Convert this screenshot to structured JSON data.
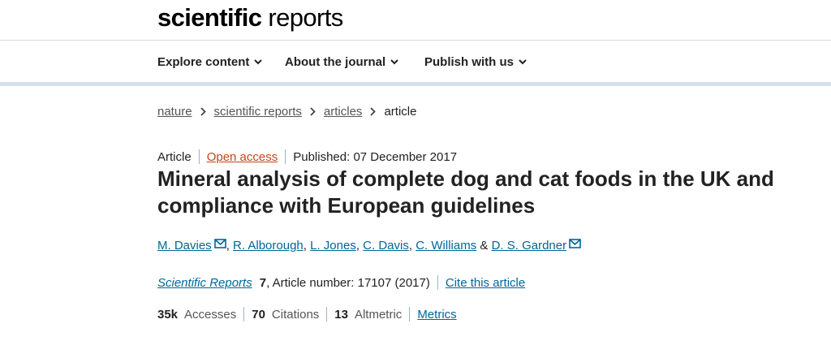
{
  "brand": {
    "logo_bold": "scientific",
    "logo_regular": "reports"
  },
  "nav": {
    "items": [
      {
        "label": "Explore content"
      },
      {
        "label": "About the journal"
      },
      {
        "label": "Publish with us"
      }
    ]
  },
  "breadcrumb": {
    "items": [
      "nature",
      "scientific reports",
      "articles"
    ],
    "current": "article"
  },
  "article": {
    "type": "Article",
    "access": "Open access",
    "published": "Published: 07 December 2017",
    "title": "Mineral analysis of complete dog and cat foods in the UK and compliance with European guidelines",
    "authors": [
      "M. Davies",
      "R. Alborough",
      "L. Jones",
      "C. Davis",
      "C. Williams",
      "D. S. Gardner"
    ],
    "authors_and": "&",
    "journal_name": "Scientific Reports",
    "volume": "7",
    "article_number": ", Article number: 17107 (2017)",
    "cite_link": "Cite this article"
  },
  "metrics": {
    "accesses_value": "35k",
    "accesses_label": "Accesses",
    "citations_value": "70",
    "citations_label": "Citations",
    "altmetric_value": "13",
    "altmetric_label": "Altmetric",
    "metrics_link": "Metrics"
  },
  "colors": {
    "link": "#006699",
    "open_access": "#c4461b",
    "nav_rule": "#d7e0ea"
  },
  "icons": {
    "nav_chevron": "chevron-down-icon",
    "crumb_separator": "chevron-right-icon",
    "corresponding_author": "envelope-icon"
  }
}
